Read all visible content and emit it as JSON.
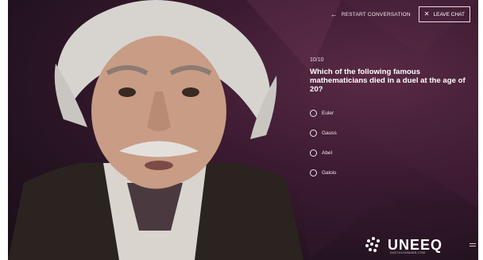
{
  "topbar": {
    "restart_label": "RESTART CONVERSATION",
    "leave_label": "LEAVE CHAT"
  },
  "quiz": {
    "progress": "10/10",
    "question": "Which of the following famous mathematicians died in a duel at the age of 20?",
    "options": [
      "Euler",
      "Gauss",
      "Abel",
      "Galois"
    ]
  },
  "brand": {
    "name": "UNEEQ",
    "tagline": "DIGITALHUMANS.COM"
  },
  "colors": {
    "background_center": "#5a2a45",
    "background_edge": "#1a0e18",
    "text": "#ffffff"
  },
  "icons": [
    "arrow-left-icon",
    "close-icon",
    "uneeq-logo-icon",
    "menu-icon"
  ]
}
